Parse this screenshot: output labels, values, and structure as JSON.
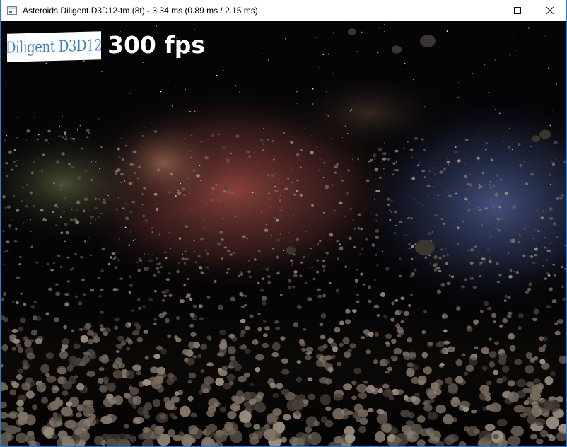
{
  "window": {
    "title": "Asteroids Diligent D3D12-tm (8t) - 3.34 ms (0.89 ms / 2.15 ms)",
    "icon": "app-window-icon",
    "controls": [
      "minimize-icon",
      "maximize-icon",
      "close-icon"
    ]
  },
  "overlay": {
    "logo_text": "Diligent D3D12",
    "fps_text": "300 fps"
  },
  "colors": {
    "space": "#050507",
    "nebula_red": "#b4564a",
    "nebula_blue": "#6072b0",
    "nebula_green": "#7d8a55",
    "asteroid": "#8a7a66",
    "logo_blue": "#3a7fcf"
  }
}
